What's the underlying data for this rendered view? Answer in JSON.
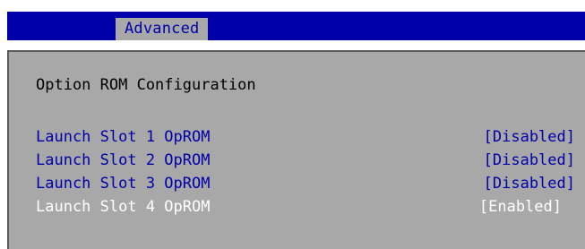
{
  "header": {
    "tabs": [
      {
        "label": "Advanced",
        "active": true
      }
    ]
  },
  "main": {
    "section_title": "Option ROM Configuration",
    "options": [
      {
        "label": "Launch Slot 1 OpROM",
        "value": "[Disabled]",
        "selected": false
      },
      {
        "label": "Launch Slot 2 OpROM",
        "value": "[Disabled]",
        "selected": false
      },
      {
        "label": "Launch Slot 3 OpROM",
        "value": "[Disabled]",
        "selected": false
      },
      {
        "label": "Launch Slot 4 OpROM",
        "value": "[Enabled]",
        "selected": true
      }
    ]
  },
  "colors": {
    "header_bg": "#0000aa",
    "panel_bg": "#a8a8a8",
    "option_text": "#0000aa",
    "selected_text": "#ffffff",
    "title_text": "#000000"
  }
}
